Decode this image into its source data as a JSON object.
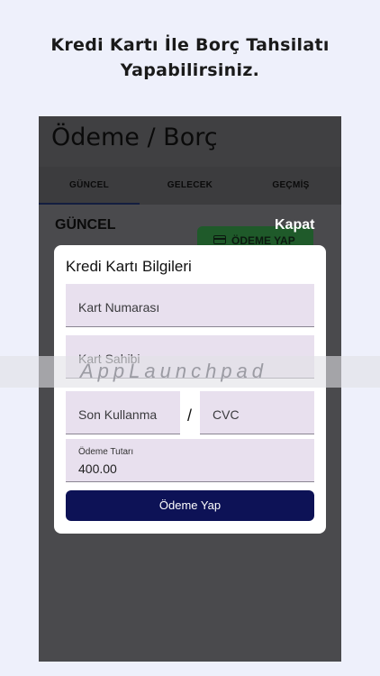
{
  "headline": {
    "line1": "Kredi Kartı İle Borç Tahsilatı",
    "line2": "Yapabilirsiniz."
  },
  "app": {
    "title": "Ödeme / Borç",
    "tabs": [
      {
        "label": "GÜNCEL",
        "selected": true
      },
      {
        "label": "GELECEK",
        "selected": false
      },
      {
        "label": "GEÇMİŞ",
        "selected": false
      }
    ],
    "section_label": "GÜNCEL",
    "pay_button_label": "ÖDEME YAP",
    "close_label": "Kapat"
  },
  "modal": {
    "title": "Kredi Kartı Bilgileri",
    "card_number_placeholder": "Kart Numarası",
    "card_holder_placeholder": "Kart Sahibi",
    "expiry_placeholder": "Son Kullanma",
    "separator": "/",
    "cvc_placeholder": "CVC",
    "amount_label": "Ödeme Tutarı",
    "amount_value": "400.00",
    "submit_label": "Ödeme Yap"
  },
  "watermark": "AppLaunchpad",
  "colors": {
    "page_background": "#eef0fb",
    "overlay": "#4a4a4d",
    "field_background": "#e8e0ee",
    "submit_button": "#0d1256",
    "pay_button": "#1f5a2a"
  }
}
